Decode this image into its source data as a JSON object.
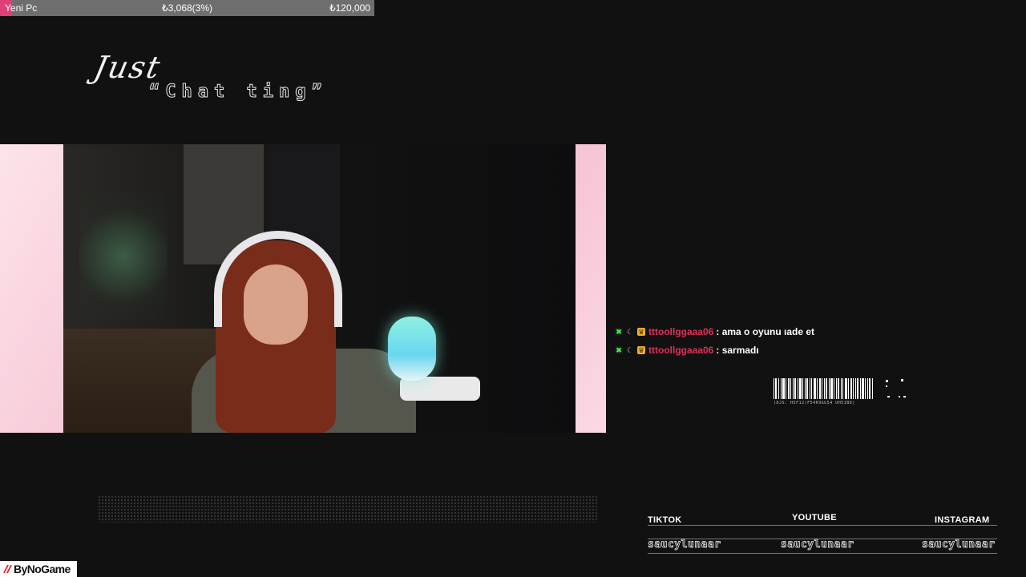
{
  "goal": {
    "name": "Yeni Pc",
    "current": "₺3,068(3%)",
    "target": "₺120,000",
    "progress_percent": 3,
    "fill_color": "#e0407a"
  },
  "category": {
    "script_title": "Just",
    "subtitle": "“Chat ting”"
  },
  "chat": {
    "messages": [
      {
        "user": "tttoollggaaa06",
        "text": ": ama o oyunu ıade et",
        "user_color": "#e0305a"
      },
      {
        "user": "tttoollggaaa06",
        "text": ": sarmadı",
        "user_color": "#e0305a"
      }
    ],
    "badges": [
      "mod-badge-icon",
      "moon-badge-icon",
      "crown-badge-icon"
    ]
  },
  "barcode": {
    "caption": "(DJS: H5F12)F54K9GG54 UH51BD)"
  },
  "socials": [
    {
      "platform": "TIKTOK",
      "handle": "saucylunaar"
    },
    {
      "platform": "YOUTUBE",
      "handle": "saucylunaar"
    },
    {
      "platform": "INSTAGRAM",
      "handle": "saucylunaar"
    }
  ],
  "logo": {
    "text": "ByNoGame",
    "icon": "bynogame-logo-icon"
  }
}
